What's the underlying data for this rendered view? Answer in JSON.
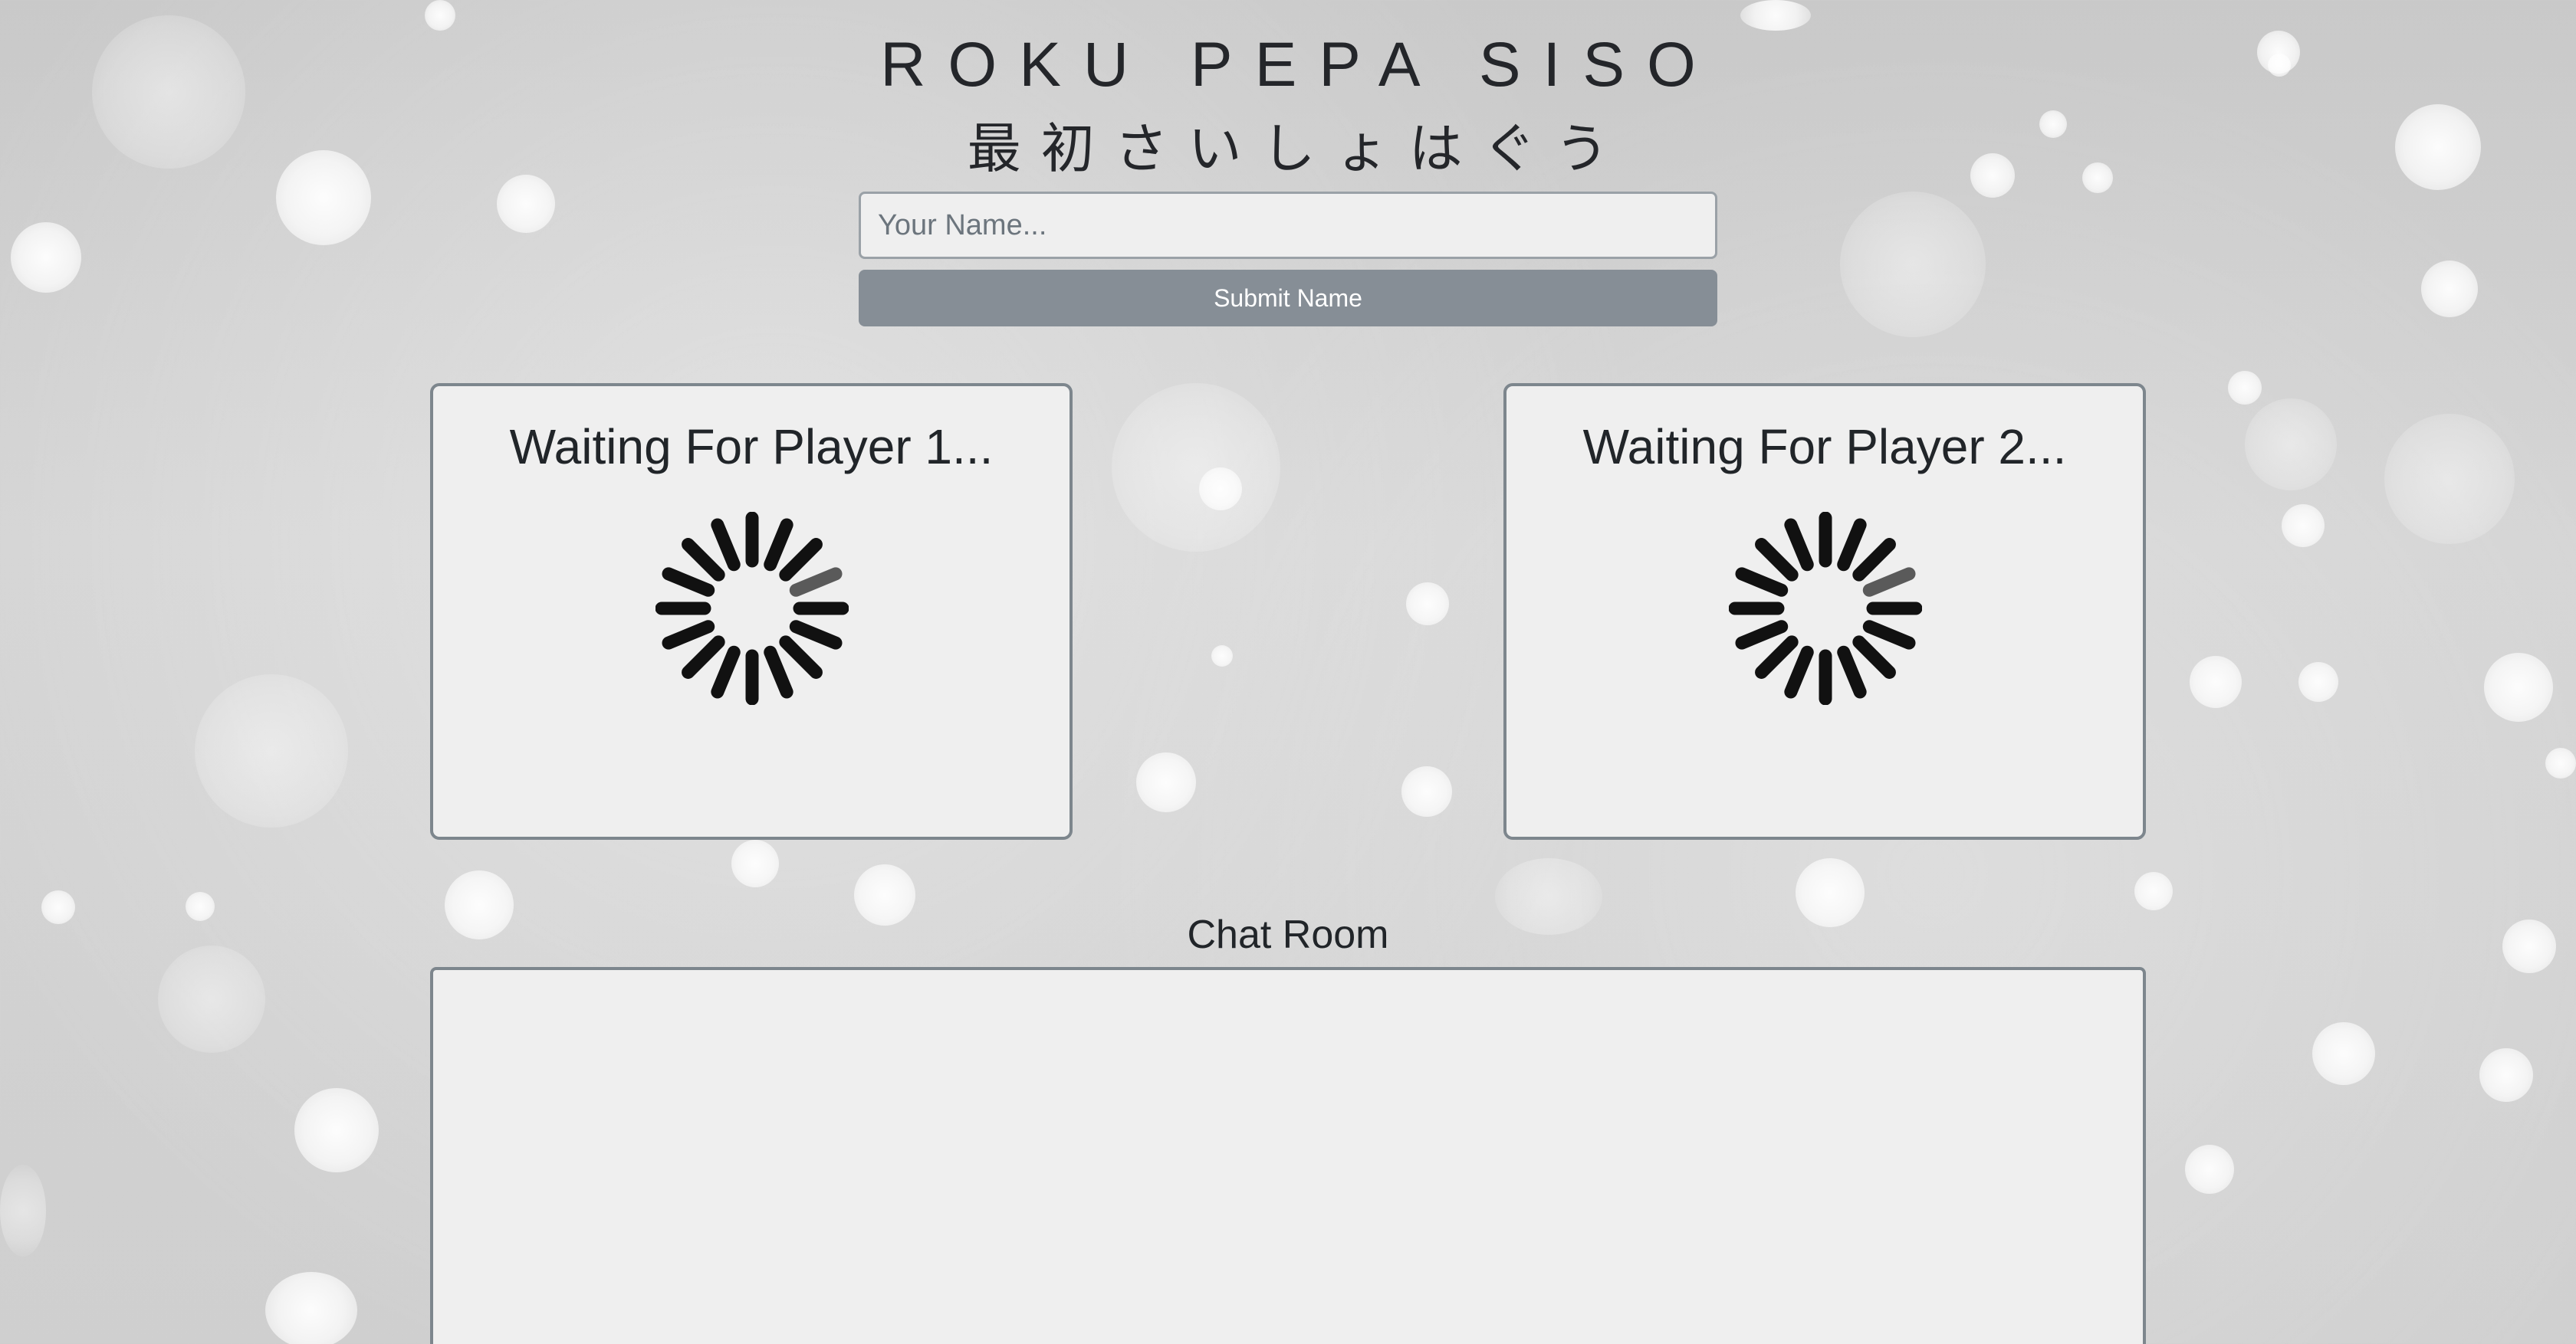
{
  "header": {
    "title": "ROKU PEPA SISO",
    "subtitle": "最初さいしょはぐう"
  },
  "name_form": {
    "placeholder": "Your Name...",
    "value": "",
    "submit_label": "Submit Name"
  },
  "players": [
    {
      "status": "Waiting For Player 1..."
    },
    {
      "status": "Waiting For Player 2..."
    }
  ],
  "chat": {
    "title": "Chat Room",
    "messages": []
  },
  "colors": {
    "button_bg": "#868e96",
    "card_border": "#7d868d",
    "card_bg": "#efefef",
    "spinner_dark": "#111111",
    "spinner_active": "#5a5a5a"
  },
  "icons": {
    "loading": "loading-spinner-icon"
  }
}
